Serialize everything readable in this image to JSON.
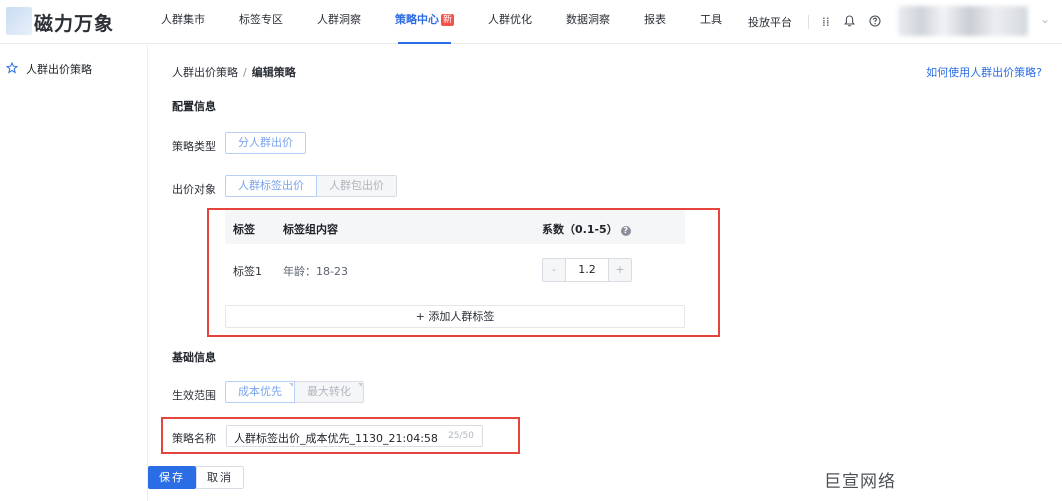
{
  "header": {
    "logo_text": "磁力万象",
    "nav": [
      {
        "label": "人群集市"
      },
      {
        "label": "标签专区"
      },
      {
        "label": "人群洞察"
      },
      {
        "label": "策略中心",
        "badge": "新",
        "active": true
      },
      {
        "label": "人群优化"
      },
      {
        "label": "数据洞察"
      },
      {
        "label": "报表"
      },
      {
        "label": "工具"
      }
    ],
    "platform_link": "投放平台",
    "icons": [
      "apps-grid-icon",
      "bell-icon",
      "help-circle-icon"
    ]
  },
  "sidebar": {
    "items": [
      {
        "label": "人群出价策略",
        "icon": "strategy-icon"
      }
    ]
  },
  "breadcrumb": {
    "parent": "人群出价策略",
    "separator": "/",
    "current": "编辑策略"
  },
  "help_link": "如何使用人群出价策略?",
  "config": {
    "title": "配置信息",
    "strategy_type_label": "策略类型",
    "strategy_type_option": "分人群出价",
    "bid_target_label": "出价对象",
    "bid_target_options": [
      "人群标签出价",
      "人群包出价"
    ]
  },
  "tag_table": {
    "headers": {
      "tag": "标签",
      "content": "标签组内容",
      "coef": "系数（0.1-5）"
    },
    "rows": [
      {
        "tag": "标签1",
        "content": "年龄：18-23",
        "coef": "1.2"
      }
    ],
    "add_button": "+ 添加人群标签",
    "minus": "-",
    "plus": "+"
  },
  "basic": {
    "title": "基础信息",
    "scope_label": "生效范围",
    "scope_options": [
      "成本优先",
      "最大转化"
    ],
    "name_label": "策略名称",
    "name_value": "人群标签出价_成本优先_1130_21:04:58",
    "name_count": "25/50"
  },
  "actions": {
    "save": "保存",
    "cancel": "取消"
  },
  "watermark": "巨宣网络",
  "colors": {
    "accent": "#2b6de5",
    "highlight_box": "#e4443b",
    "badge": "#f2544c"
  }
}
